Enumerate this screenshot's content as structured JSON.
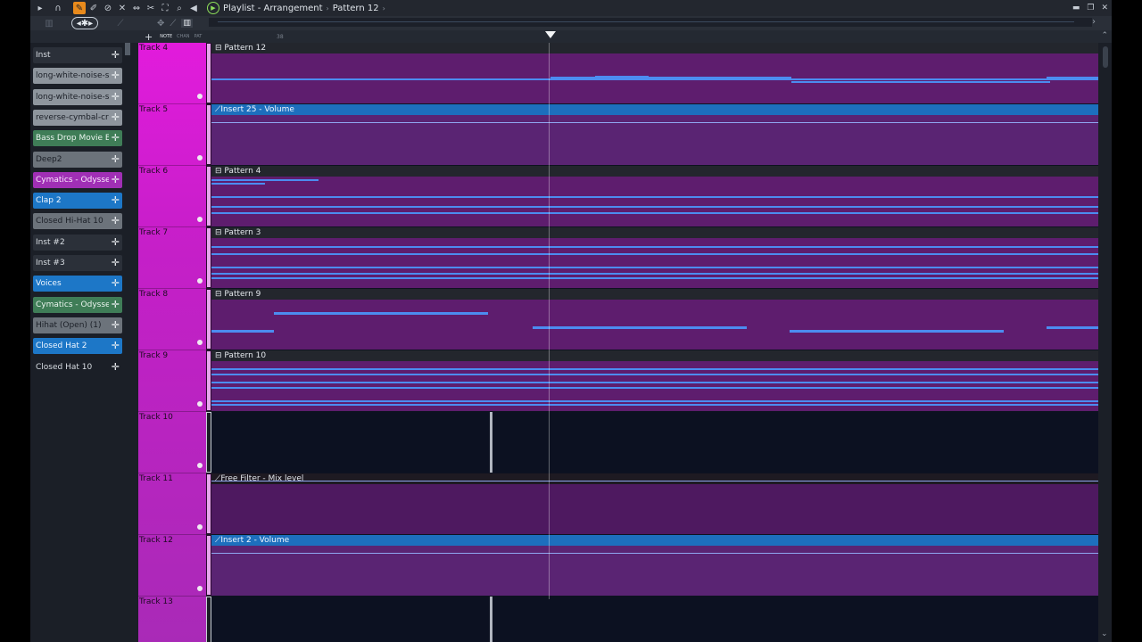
{
  "titlebar": {
    "crumbs": [
      "Playlist - Arrangement",
      "Pattern 12"
    ],
    "tools": [
      "arrow-icon",
      "magnet-icon",
      "pencil-icon",
      "brush-icon",
      "mute-icon",
      "slip-icon",
      "mute-tool-icon",
      "slice-icon",
      "select-icon",
      "zoom-icon",
      "speaker-icon"
    ],
    "window_controls": [
      "minimize-icon",
      "restore-icon",
      "close-icon"
    ]
  },
  "toolbar": {
    "modes": [
      "piano-roll-icon",
      "audio-icon",
      "automation-icon"
    ],
    "ruler_labels": {
      "plus": "+",
      "note": "NOTE",
      "chan": "CHAN",
      "pat": "PAT"
    },
    "bar_number": "38"
  },
  "channels": [
    {
      "name": "Inst",
      "style": "dark"
    },
    {
      "name": "long-white-noise-s...",
      "style": "gray"
    },
    {
      "name": "long-white-noise-s...",
      "style": "gray"
    },
    {
      "name": "reverse-cymbal-crash",
      "style": "gray"
    },
    {
      "name": "Bass Drop Movie Effe...",
      "style": "green"
    },
    {
      "name": "Deep2",
      "style": "gray2"
    },
    {
      "name": "Cymatics - Odyssey K...",
      "style": "purple"
    },
    {
      "name": "Clap 2",
      "style": "blue"
    },
    {
      "name": "Closed Hi-Hat 10",
      "style": "gray2"
    },
    {
      "name": "Inst #2",
      "style": "dark"
    },
    {
      "name": "Inst #3",
      "style": "dark"
    },
    {
      "name": "Voices",
      "style": "blue"
    },
    {
      "name": "Cymatics - Odyssey...",
      "style": "green"
    },
    {
      "name": "Hihat (Open) (1)",
      "style": "gray2"
    },
    {
      "name": "Closed Hat 2",
      "style": "blue"
    },
    {
      "name": "Closed Hat 10",
      "style": "none"
    }
  ],
  "tracks": [
    {
      "name": "Track 4",
      "clip": "Pattern 12",
      "kind": "pattern"
    },
    {
      "name": "Track 5",
      "clip": "Insert 25 - Volume",
      "kind": "auto-blue"
    },
    {
      "name": "Track 6",
      "clip": "Pattern 4",
      "kind": "pattern"
    },
    {
      "name": "Track 7",
      "clip": "Pattern 3",
      "kind": "pattern"
    },
    {
      "name": "Track 8",
      "clip": "Pattern 9",
      "kind": "pattern"
    },
    {
      "name": "Track 9",
      "clip": "Pattern 10",
      "kind": "pattern"
    },
    {
      "name": "Track 10",
      "clip": "",
      "kind": "empty"
    },
    {
      "name": "Track 11",
      "clip": "Free Filter - Mix level",
      "kind": "auto-dark"
    },
    {
      "name": "Track 12",
      "clip": "Insert 2 - Volume",
      "kind": "auto-blue"
    },
    {
      "name": "Track 13",
      "clip": "",
      "kind": "empty"
    }
  ],
  "colors": {
    "track_header": "#e21bdc",
    "clip_purple": "#5e1d6e",
    "note_blue": "#4c8cf0",
    "automation_blue": "#1d6fbd",
    "playhead": "#ffffff"
  }
}
